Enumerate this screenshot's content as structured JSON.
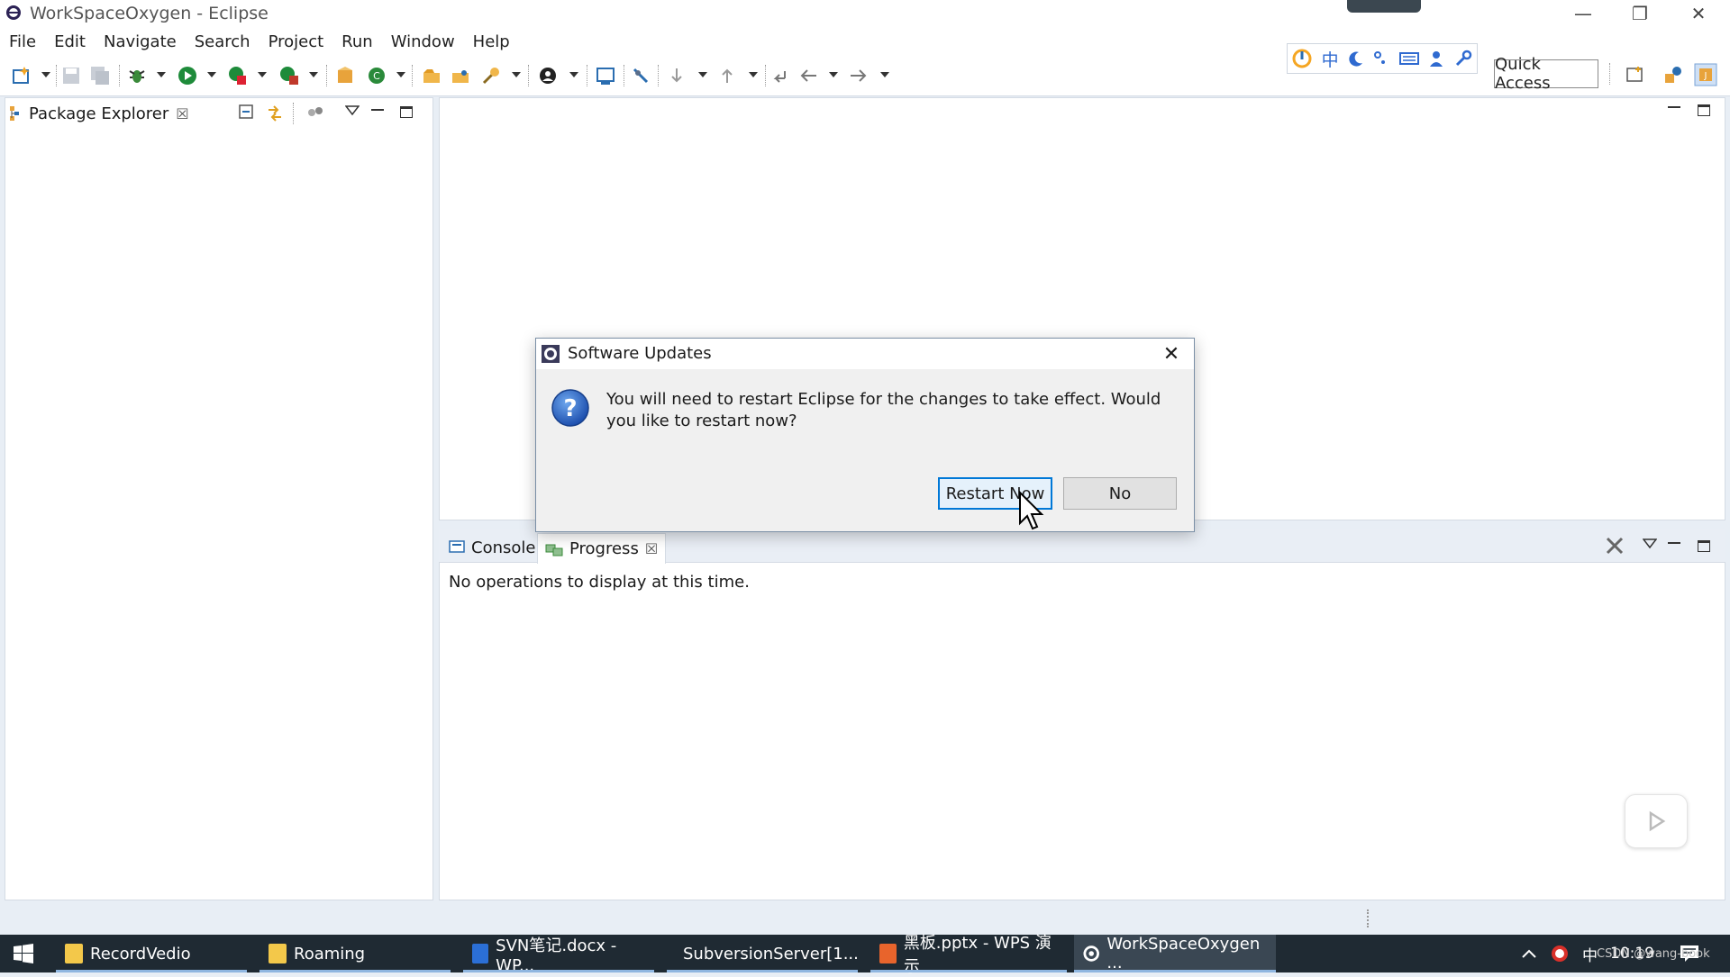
{
  "window": {
    "title": "WorkSpaceOxygen - Eclipse",
    "minimize_glyph": "—",
    "restore_glyph": "❐",
    "close_glyph": "✕"
  },
  "menubar": {
    "items": [
      "File",
      "Edit",
      "Navigate",
      "Search",
      "Project",
      "Run",
      "Window",
      "Help"
    ]
  },
  "ime_toolbar": {
    "chinese_char": "中"
  },
  "quick_access": {
    "label": "Quick Access"
  },
  "package_explorer": {
    "tab_label": "Package Explorer",
    "close_glyph": "☒"
  },
  "bottom_panel": {
    "tabs": [
      {
        "label": "Console"
      },
      {
        "label": "Progress"
      }
    ],
    "progress_message": "No operations to display at this time."
  },
  "dialog": {
    "title": "Software Updates",
    "close_glyph": "✕",
    "message": "You will need to restart Eclipse for the changes to take effect. Would you like to restart now?",
    "restart_label": "Restart Now",
    "no_label": "No"
  },
  "taskbar": {
    "items": [
      {
        "label": "RecordVedio",
        "icon": "folder-icon"
      },
      {
        "label": "Roaming",
        "icon": "folder-icon"
      },
      {
        "label": "SVN笔记.docx - WP...",
        "icon": "wps-writer-icon"
      },
      {
        "label": "SubversionServer[1...",
        "icon": "server-icon"
      },
      {
        "label": "黑板.pptx - WPS 演示",
        "icon": "wps-presentation-icon"
      },
      {
        "label": "WorkSpaceOxygen ...",
        "icon": "eclipse-icon"
      }
    ],
    "tray": {
      "ime": "中",
      "time": "10:19",
      "watermark": "CSDN @wang-book"
    }
  },
  "colors": {
    "accent": "#0078d7",
    "taskbar": "#1f2a33",
    "workbench_bg": "#e8eef5"
  }
}
